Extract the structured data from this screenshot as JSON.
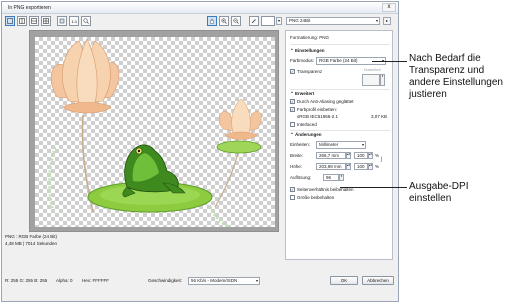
{
  "window": {
    "title": "In PNG exportieren",
    "close": "x"
  },
  "toolbar": {
    "format_value": "PNG 24Bit"
  },
  "panel": {
    "format_row": "Formatierung: PNG",
    "sec_settings": "Einstellungen",
    "color_mode_label": "Farbmodus:",
    "color_mode_value": "RGB Farbe (24 Bit)",
    "transparency_label": "Transparenz",
    "dither_label": "Dunkelheit",
    "sec_advanced": "Erweitert",
    "anti_alias_label": "Durch Anti-Aliasing geglättet",
    "embed_profile_label": "Farbprofil einbetten:",
    "profile_name": "sRGB IEC61966-2.1",
    "profile_size": "3,07 KB",
    "interlaced_label": "Interlaced",
    "sec_changes": "Änderungen",
    "units_label": "Einheiten:",
    "units_value": "Millimeter",
    "width_label": "Breite:",
    "width_value": "266,7 mm",
    "width_pct": "100",
    "height_label": "Höhe:",
    "height_value": "203,99 mm",
    "height_pct": "100",
    "pct_sign": "%",
    "resolution_label": "Auflösung:",
    "resolution_value": "96",
    "keep_ratio_label": "Seitenverhältnis beibehalten",
    "keep_size_label": "Größe beibehalten"
  },
  "info": {
    "line1": "PNG : RGB Farbe (24 Bit)",
    "line2": "4,48 MB | 7014 Sekunden"
  },
  "statusbar": {
    "rgb": "R: 255  G: 255  B: 255",
    "alpha": "Alpha: 0",
    "hex": "Hex: FFFFFF",
    "speed_label": "Geschwindigkeit:",
    "speed_value": "56 Kb/s - Modem/ISDN",
    "ok": "OK",
    "cancel": "Abbrechen"
  },
  "callouts": {
    "top": "Nach Bedarf die Transparenz und andere Einstellungen justieren",
    "bottom": "Ausgabe-DPI einstellen"
  },
  "colors": {
    "lily_pad": "#8ccc3e",
    "frog_green": "#3e8a1f",
    "lotus_pink": "#f2b98f",
    "accent_blue": "#3b79c3"
  }
}
